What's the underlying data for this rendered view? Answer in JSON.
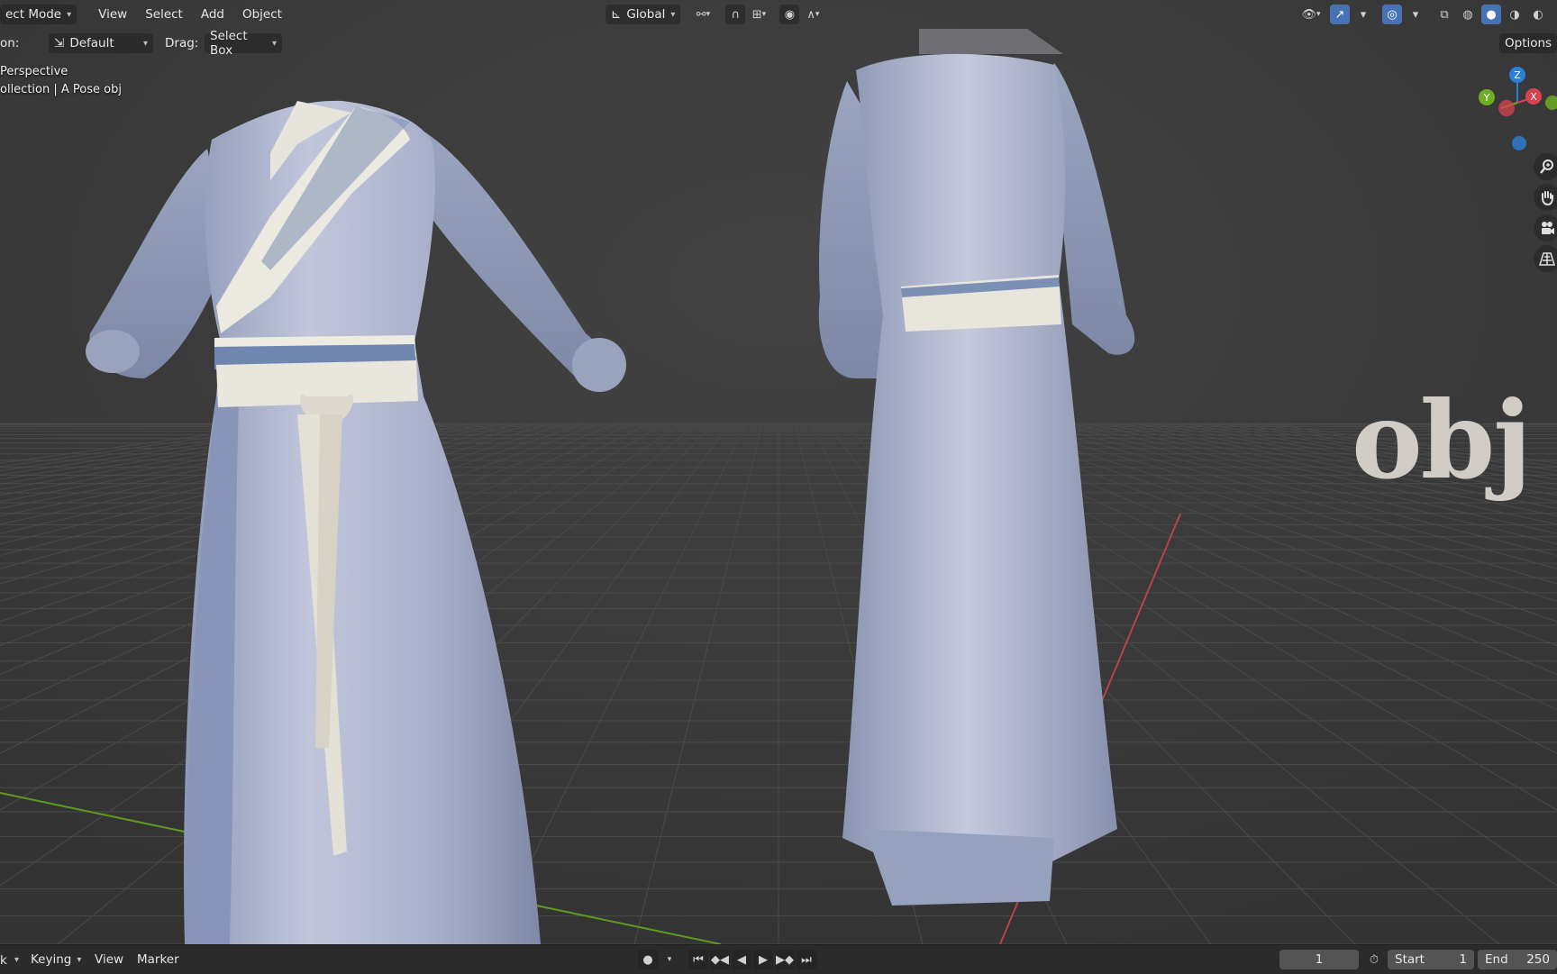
{
  "header": {
    "mode": "ect Mode",
    "menus": [
      "View",
      "Select",
      "Add",
      "Object"
    ],
    "transform_orientation": "Global",
    "overlay_options": "Options"
  },
  "tool_header": {
    "orientation_label": "on:",
    "pivot_value": "Default",
    "drag_label": "Drag:",
    "drag_value": "Select Box"
  },
  "viewport": {
    "view_name": "Perspective",
    "collection_info": "ollection | A Pose obj",
    "watermark": "obj",
    "gizmo_axes": {
      "z": "Z",
      "y": "Y",
      "x": "X"
    },
    "icons": [
      "zoom-icon",
      "hand-pan-icon",
      "camera-icon",
      "perspective-grid-icon"
    ]
  },
  "timeline": {
    "mode": "k",
    "keying": "Keying",
    "view": "View",
    "marker": "Marker",
    "current_frame": "1",
    "start_label": "Start",
    "start_value": "1",
    "end_label": "End",
    "end_value": "250"
  },
  "colors": {
    "viewport_bg": "#3c3c3c",
    "accent_blue": "#4772b3",
    "axis_x": "#d8424f",
    "axis_y": "#6fae22",
    "axis_z": "#2a7fd8"
  }
}
